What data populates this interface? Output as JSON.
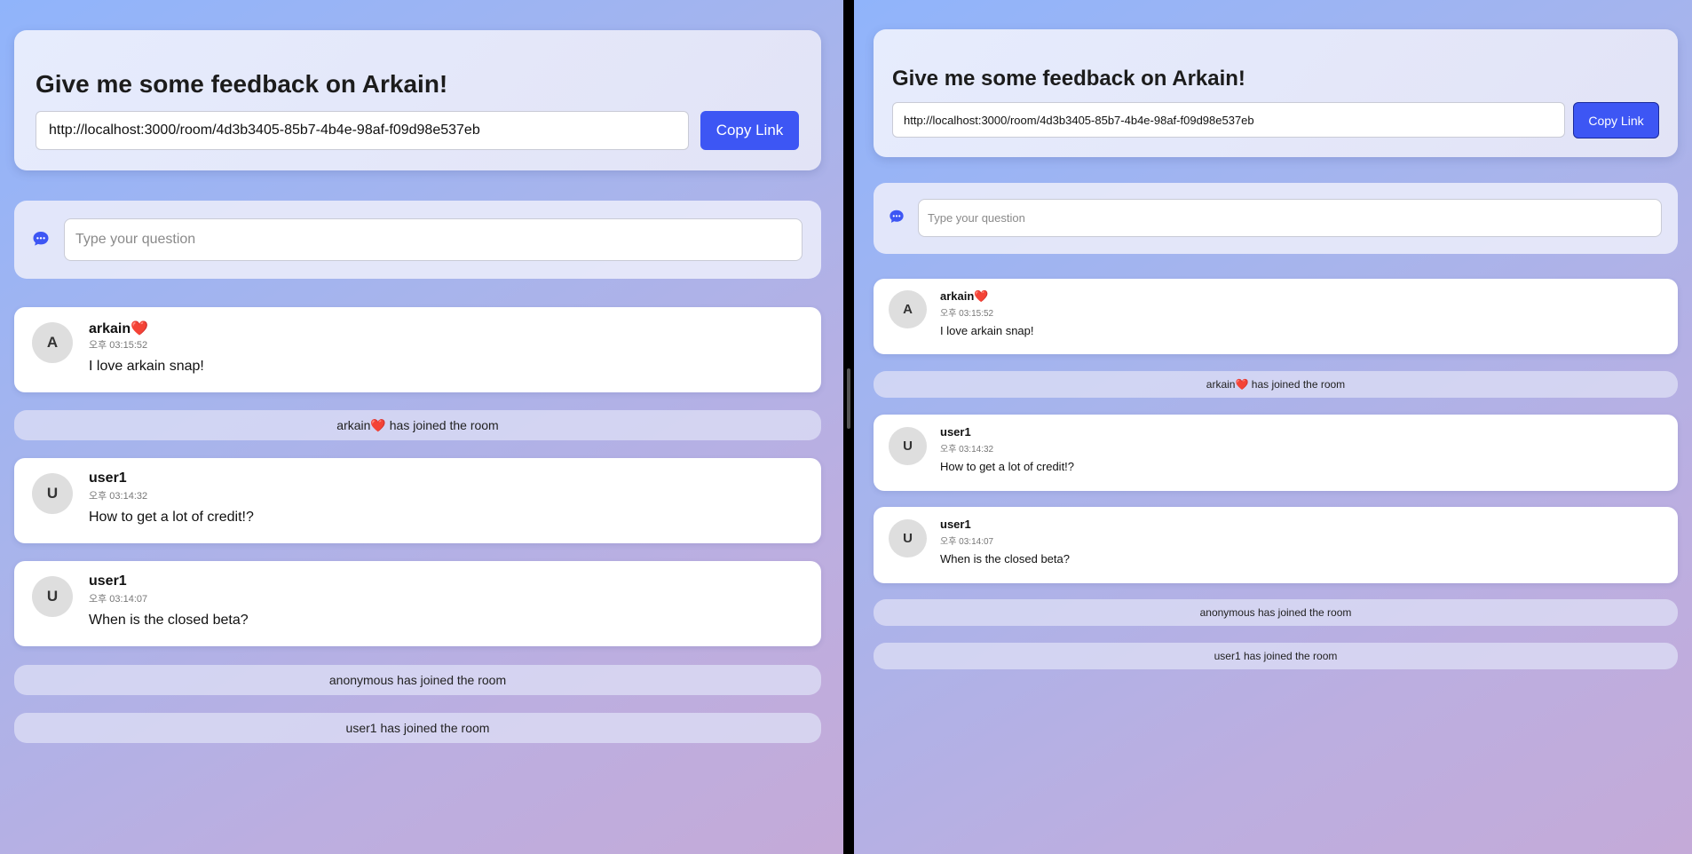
{
  "room": {
    "title": "Give me some feedback on Arkain!",
    "share_url": "http://localhost:3000/room/4d3b3405-85b7-4b4e-98af-f09d98e537eb",
    "copy_label": "Copy Link"
  },
  "composer": {
    "placeholder": "Type your question",
    "icon": "chat-bubble-icon"
  },
  "feed": [
    {
      "type": "message",
      "avatar": "A",
      "user": "arkain",
      "user_emoji": "❤️",
      "time": "오후 03:15:52",
      "text": "I love arkain snap!"
    },
    {
      "type": "system",
      "user": "arkain",
      "user_emoji": "❤️",
      "text": "has joined the room"
    },
    {
      "type": "message",
      "avatar": "U",
      "user": "user1",
      "user_emoji": "",
      "time": "오후 03:14:32",
      "text": "How to get a lot of credit!?"
    },
    {
      "type": "message",
      "avatar": "U",
      "user": "user1",
      "user_emoji": "",
      "time": "오후 03:14:07",
      "text": "When is the closed beta?"
    },
    {
      "type": "system",
      "user": "anonymous",
      "user_emoji": "",
      "text": "has joined the room"
    },
    {
      "type": "system",
      "user": "user1",
      "user_emoji": "",
      "text": "has joined the room"
    }
  ],
  "colors": {
    "accent": "#3d56f4",
    "heart": "#e3262e",
    "background_start": "#90b4fb",
    "background_end": "#c4aad8"
  }
}
